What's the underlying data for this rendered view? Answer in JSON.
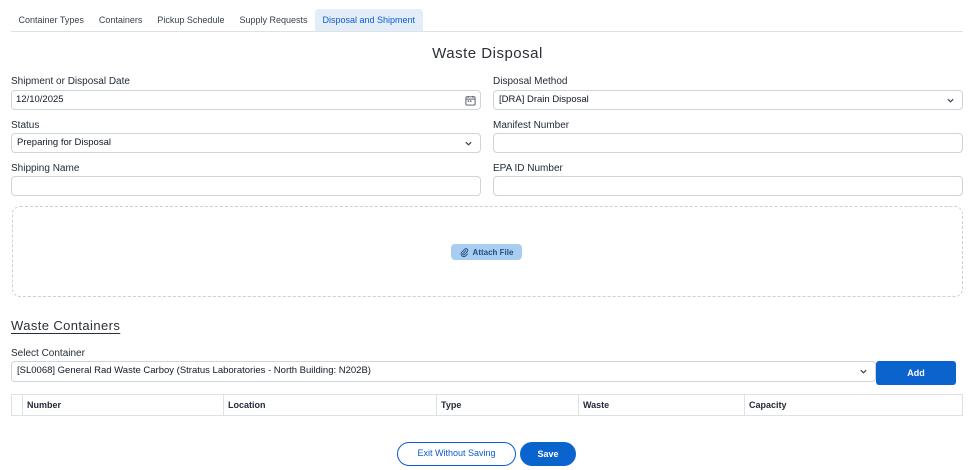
{
  "tabs": [
    {
      "label": "Container Types",
      "active": false
    },
    {
      "label": "Containers",
      "active": false
    },
    {
      "label": "Pickup Schedule",
      "active": false
    },
    {
      "label": "Supply Requests",
      "active": false
    },
    {
      "label": "Disposal and Shipment",
      "active": true
    }
  ],
  "page_title": "Waste Disposal",
  "form": {
    "shipment_date": {
      "label": "Shipment or Disposal Date",
      "value": "12/10/2025",
      "icon": "calendar-icon"
    },
    "disposal_method": {
      "label": "Disposal Method",
      "value": "[DRA] Drain Disposal"
    },
    "status": {
      "label": "Status",
      "value": "Preparing for Disposal"
    },
    "manifest_number": {
      "label": "Manifest Number",
      "value": ""
    },
    "shipping_name": {
      "label": "Shipping Name",
      "value": ""
    },
    "epa_id_number": {
      "label": "EPA ID Number",
      "value": ""
    }
  },
  "attach": {
    "label": "Attach File",
    "icon": "paperclip-icon"
  },
  "waste_containers": {
    "title": "Waste Containers",
    "select_label": "Select Container",
    "selected": "[SL0068] General Rad Waste Carboy (Stratus Laboratories - North Building: N202B)",
    "add_label": "Add",
    "columns": [
      "Number",
      "Location",
      "Type",
      "Waste",
      "Capacity"
    ]
  },
  "actions": {
    "exit_label": "Exit Without Saving",
    "save_label": "Save"
  },
  "colors": {
    "primary": "#0b63ce",
    "active_tab_bg": "#e3edf8",
    "attach_bg": "#a9cdf0"
  }
}
